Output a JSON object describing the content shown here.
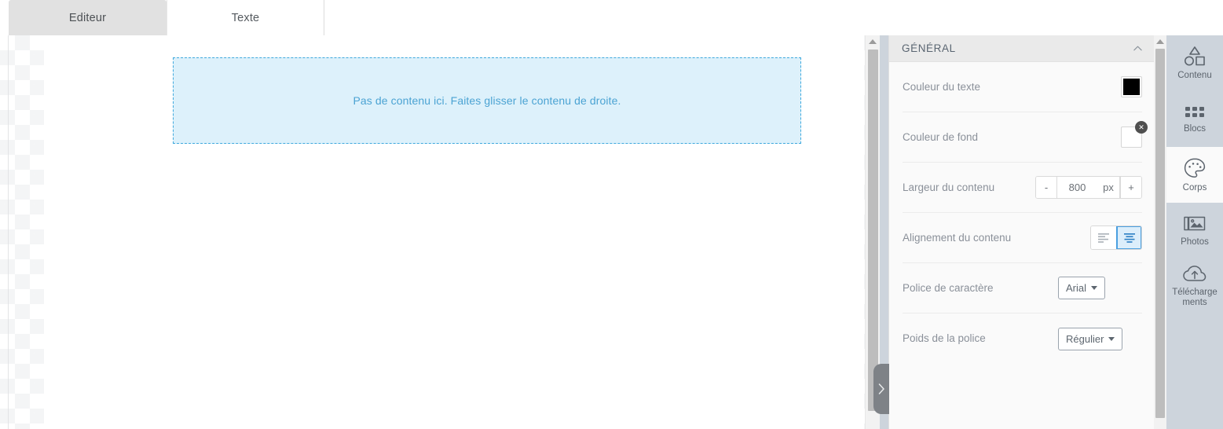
{
  "tabs": [
    {
      "label": "Editeur",
      "active": false,
      "name": "tab-editeur"
    },
    {
      "label": "Texte",
      "active": true,
      "name": "tab-texte"
    }
  ],
  "canvas": {
    "dropzone_text": "Pas de contenu ici. Faites glisser le contenu de droite.",
    "dropzone_border_color": "#3fa9dd",
    "dropzone_background": "#ddf1fb",
    "dropzone_text_color": "#4ba3d3"
  },
  "collapse_handle": {
    "icon": "chevron-right-icon",
    "color": "#7e8287"
  },
  "panel": {
    "header": {
      "title": "GÉNÉRAL",
      "collapse_icon": "chevron-up-icon"
    },
    "rows": [
      {
        "label": "Couleur du texte",
        "control": "color-swatch",
        "value": "#000000",
        "clearable": false
      },
      {
        "label": "Couleur de fond",
        "control": "color-swatch",
        "value": "#ffffff",
        "clearable": true,
        "clear_label": "✕"
      },
      {
        "label": "Largeur du contenu",
        "control": "stepper",
        "decrement_label": "-",
        "value": "800",
        "unit": "px",
        "increment_label": "+"
      },
      {
        "label": "Alignement du contenu",
        "control": "segmented",
        "options": [
          {
            "icon": "align-left-icon",
            "active": false
          },
          {
            "icon": "align-center-icon",
            "active": true
          }
        ],
        "active_color": "#4a9fe0"
      },
      {
        "label": "Police de caractère",
        "control": "dropdown",
        "value": "Arial"
      },
      {
        "label": "Poids de la police",
        "control": "dropdown",
        "value": "Régulier"
      }
    ]
  },
  "rail": {
    "items": [
      {
        "label": "Contenu",
        "icon": "shapes-icon",
        "active": false
      },
      {
        "label": "Blocs",
        "icon": "grid-dots-icon",
        "active": false
      },
      {
        "label": "Corps",
        "icon": "palette-icon",
        "active": true
      },
      {
        "label": "Photos",
        "icon": "images-icon",
        "active": false
      },
      {
        "label": "Téléchargements",
        "icon": "cloud-upload-icon",
        "active": false
      }
    ]
  }
}
